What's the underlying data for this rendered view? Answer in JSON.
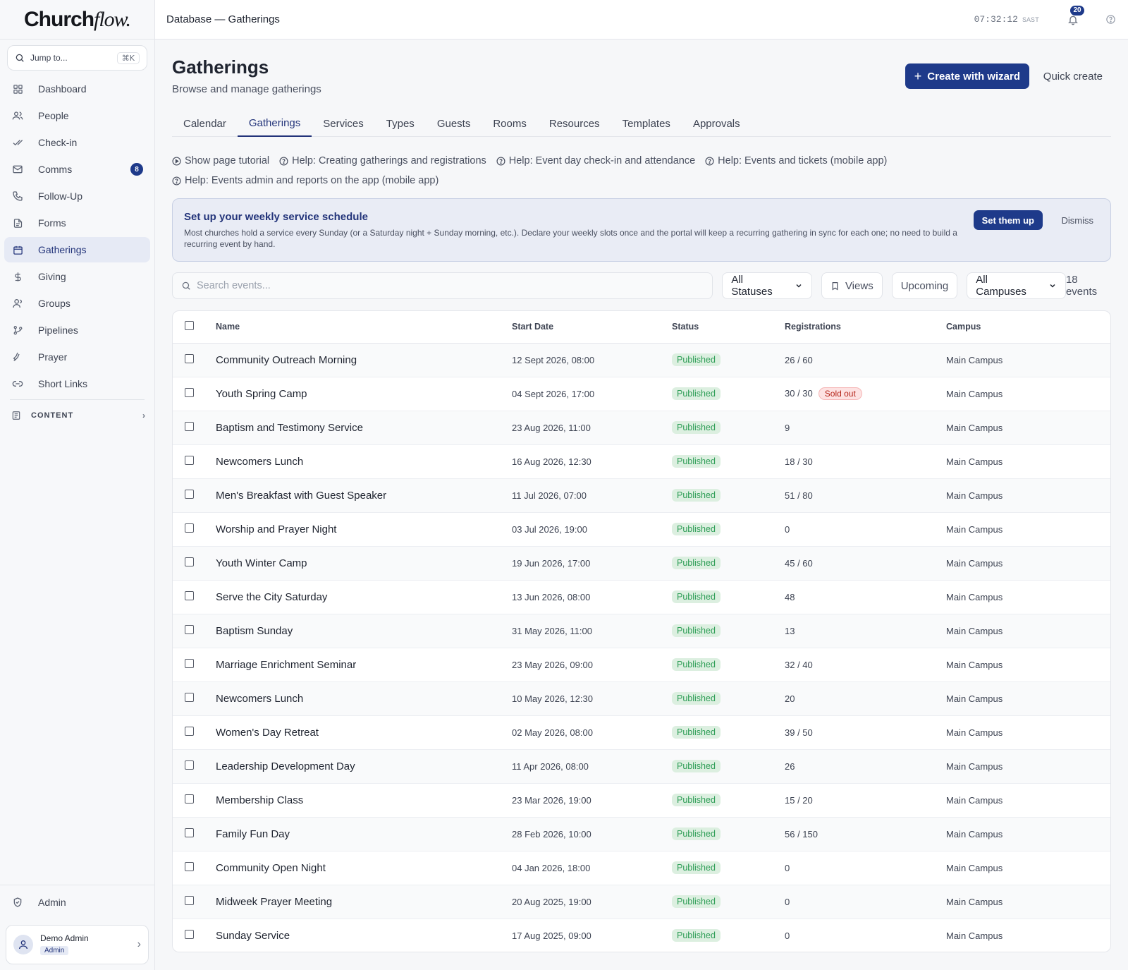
{
  "brand": {
    "name_bold": "Church",
    "name_italic": "flow."
  },
  "sidebar": {
    "jump_placeholder": "Jump to...",
    "jump_shortcut": "⌘K",
    "items": [
      {
        "label": "Dashboard",
        "icon": "grid-icon"
      },
      {
        "label": "People",
        "icon": "people-icon"
      },
      {
        "label": "Check-in",
        "icon": "check-icon"
      },
      {
        "label": "Comms",
        "icon": "mail-icon",
        "badge": "8"
      },
      {
        "label": "Follow-Up",
        "icon": "phone-icon"
      },
      {
        "label": "Forms",
        "icon": "file-icon"
      },
      {
        "label": "Gatherings",
        "icon": "calendar-icon",
        "active": true
      },
      {
        "label": "Giving",
        "icon": "dollar-icon"
      },
      {
        "label": "Groups",
        "icon": "group-icon"
      },
      {
        "label": "Pipelines",
        "icon": "pipeline-icon"
      },
      {
        "label": "Prayer",
        "icon": "prayer-icon"
      },
      {
        "label": "Short Links",
        "icon": "link-icon"
      }
    ],
    "section": "CONTENT",
    "admin_label": "Admin",
    "user": {
      "name": "Demo Admin",
      "role": "Admin"
    }
  },
  "topbar": {
    "breadcrumb": "Database — Gatherings",
    "time": "07:32:12",
    "timezone": "SAST",
    "notifications": "20"
  },
  "page": {
    "title": "Gatherings",
    "subtitle": "Browse and manage gatherings",
    "create_button": "Create with wizard",
    "quick_create": "Quick create"
  },
  "tabs": [
    "Calendar",
    "Gatherings",
    "Services",
    "Types",
    "Guests",
    "Rooms",
    "Resources",
    "Templates",
    "Approvals"
  ],
  "active_tab": "Gatherings",
  "help_links": [
    "Show page tutorial",
    "Help: Creating gatherings and registrations",
    "Help: Event day check-in and attendance",
    "Help: Events and tickets (mobile app)",
    "Help: Events admin and reports on the app (mobile app)"
  ],
  "banner": {
    "title": "Set up your weekly service schedule",
    "text": "Most churches hold a service every Sunday (or a Saturday night + Sunday morning, etc.). Declare your weekly slots once and the portal will keep a recurring gathering in sync for each one; no need to build a recurring event by hand.",
    "setup_button": "Set them up",
    "dismiss_button": "Dismiss"
  },
  "toolbar": {
    "search_placeholder": "Search events...",
    "status_filter": "All Statuses",
    "views": "Views",
    "upcoming": "Upcoming",
    "campus_filter": "All Campuses",
    "count": "18 events"
  },
  "table": {
    "columns": [
      "Name",
      "Start Date",
      "Status",
      "Registrations",
      "Campus"
    ],
    "rows": [
      {
        "name": "Community Outreach Morning",
        "start": "12 Sept 2026, 08:00",
        "status": "Published",
        "registrations": "26 / 60",
        "campus": "Main Campus"
      },
      {
        "name": "Youth Spring Camp",
        "start": "04 Sept 2026, 17:00",
        "status": "Published",
        "registrations": "30 / 30",
        "flag": "Sold out",
        "campus": "Main Campus"
      },
      {
        "name": "Baptism and Testimony Service",
        "start": "23 Aug 2026, 11:00",
        "status": "Published",
        "registrations": "9",
        "campus": "Main Campus"
      },
      {
        "name": "Newcomers Lunch",
        "start": "16 Aug 2026, 12:30",
        "status": "Published",
        "registrations": "18 / 30",
        "campus": "Main Campus"
      },
      {
        "name": "Men's Breakfast with Guest Speaker",
        "start": "11 Jul 2026, 07:00",
        "status": "Published",
        "registrations": "51 / 80",
        "campus": "Main Campus"
      },
      {
        "name": "Worship and Prayer Night",
        "start": "03 Jul 2026, 19:00",
        "status": "Published",
        "registrations": "0",
        "campus": "Main Campus"
      },
      {
        "name": "Youth Winter Camp",
        "start": "19 Jun 2026, 17:00",
        "status": "Published",
        "registrations": "45 / 60",
        "campus": "Main Campus"
      },
      {
        "name": "Serve the City Saturday",
        "start": "13 Jun 2026, 08:00",
        "status": "Published",
        "registrations": "48",
        "campus": "Main Campus"
      },
      {
        "name": "Baptism Sunday",
        "start": "31 May 2026, 11:00",
        "status": "Published",
        "registrations": "13",
        "campus": "Main Campus"
      },
      {
        "name": "Marriage Enrichment Seminar",
        "start": "23 May 2026, 09:00",
        "status": "Published",
        "registrations": "32 / 40",
        "campus": "Main Campus"
      },
      {
        "name": "Newcomers Lunch",
        "start": "10 May 2026, 12:30",
        "status": "Published",
        "registrations": "20",
        "campus": "Main Campus"
      },
      {
        "name": "Women's Day Retreat",
        "start": "02 May 2026, 08:00",
        "status": "Published",
        "registrations": "39 / 50",
        "campus": "Main Campus"
      },
      {
        "name": "Leadership Development Day",
        "start": "11 Apr 2026, 08:00",
        "status": "Published",
        "registrations": "26",
        "campus": "Main Campus"
      },
      {
        "name": "Membership Class",
        "start": "23 Mar 2026, 19:00",
        "status": "Published",
        "registrations": "15 / 20",
        "campus": "Main Campus"
      },
      {
        "name": "Family Fun Day",
        "start": "28 Feb 2026, 10:00",
        "status": "Published",
        "registrations": "56 / 150",
        "campus": "Main Campus"
      },
      {
        "name": "Community Open Night",
        "start": "04 Jan 2026, 18:00",
        "status": "Published",
        "registrations": "0",
        "campus": "Main Campus"
      },
      {
        "name": "Midweek Prayer Meeting",
        "start": "20 Aug 2025, 19:00",
        "status": "Published",
        "registrations": "0",
        "campus": "Main Campus"
      },
      {
        "name": "Sunday Service",
        "start": "17 Aug 2025, 09:00",
        "status": "Published",
        "registrations": "0",
        "campus": "Main Campus"
      }
    ]
  }
}
